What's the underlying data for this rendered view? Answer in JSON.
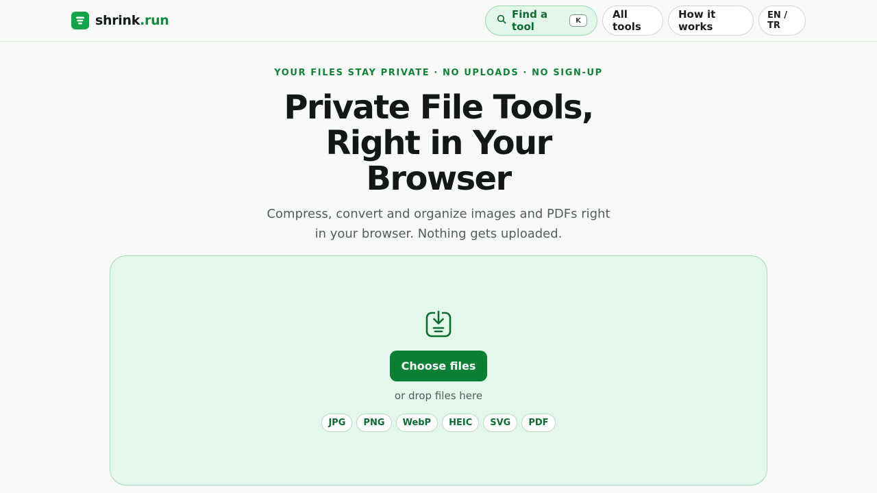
{
  "header": {
    "brand": {
      "name": "shrink",
      "tld": ".run"
    },
    "nav": {
      "find_tool_label": "Find a tool",
      "find_tool_shortcut": "K",
      "all_tools_label": "All tools",
      "how_it_works_label": "How it works",
      "language_label": "EN / TR"
    }
  },
  "hero": {
    "eyebrow": "YOUR FILES STAY PRIVATE · NO UPLOADS · NO SIGN-UP",
    "title": "Private File Tools, Right in Your Browser",
    "subtitle": "Compress, convert and organize images and PDFs right in your browser. Nothing gets uploaded."
  },
  "dropzone": {
    "icon": "download-tray-icon",
    "choose_button_label": "Choose files",
    "hint": "or drop files here",
    "formats": [
      "JPG",
      "PNG",
      "WebP",
      "HEIC",
      "SVG",
      "PDF"
    ]
  },
  "colors": {
    "brand_green": "#14a34a",
    "button_green": "#0a7f35",
    "dropzone_bg": "#e4f7eb",
    "dropzone_border": "#a8d8b7",
    "page_bg": "#f8faf7"
  }
}
